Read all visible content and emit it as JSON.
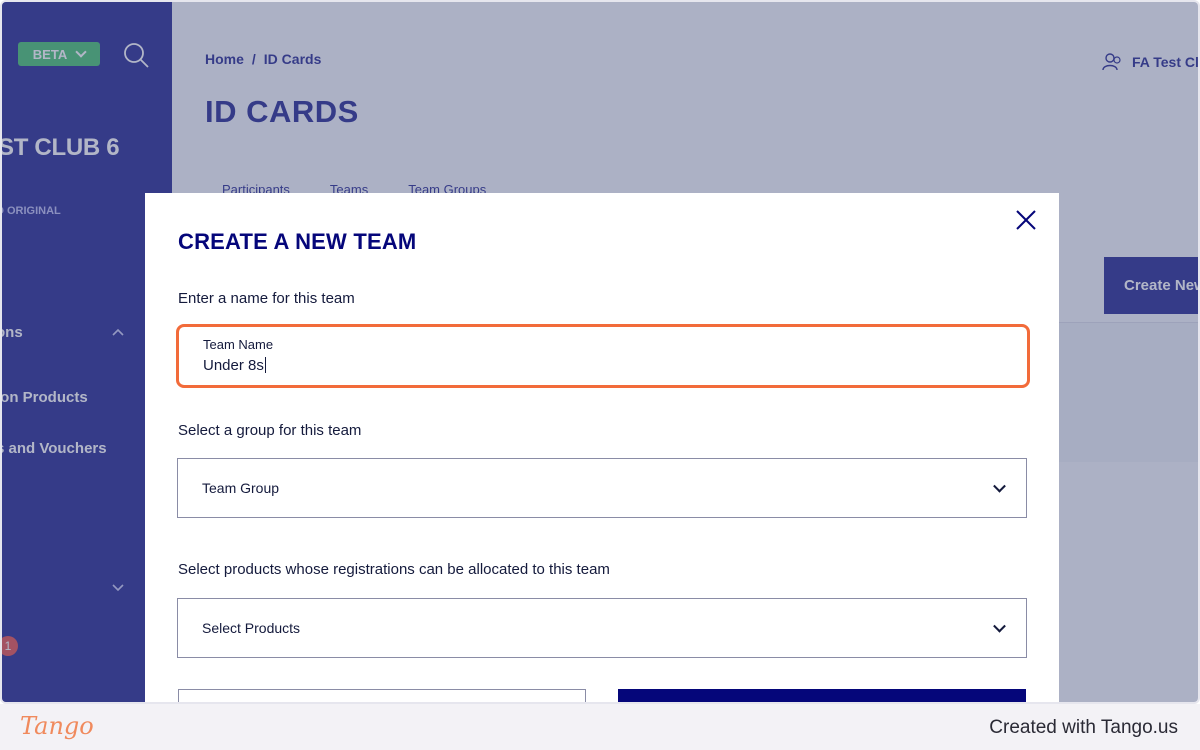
{
  "sidebar": {
    "beta_label": "BETA",
    "club_name": "ST CLUB 6",
    "club_sub": "D ORIGINAL",
    "items": [
      {
        "label": "ons"
      },
      {
        "label": "ion Products"
      },
      {
        "label": "s and Vouchers"
      }
    ],
    "notification_count": "1"
  },
  "header": {
    "breadcrumb": [
      "Home",
      "ID Cards"
    ],
    "breadcrumb_separator": "/",
    "page_title": "ID CARDS",
    "account_label": "FA Test Clu"
  },
  "tabs": [
    "Participants",
    "Teams",
    "Team Groups"
  ],
  "create_new_label": "Create New",
  "modal": {
    "title": "CREATE A NEW TEAM",
    "name_prompt": "Enter a name for this team",
    "team_name_label": "Team Name",
    "team_name_value": "Under 8s",
    "group_prompt": "Select a group for this team",
    "group_select": "Team Group",
    "products_prompt": "Select products whose registrations can be allocated to this team",
    "products_select": "Select Products"
  },
  "footer": {
    "logo": "Tango",
    "credit": "Created with Tango.us"
  },
  "colors": {
    "brand_navy": "#05067a",
    "sidebar": "#1d1f8c",
    "focus_ring": "#f26b3a",
    "beta_badge": "#3fbf6b"
  }
}
